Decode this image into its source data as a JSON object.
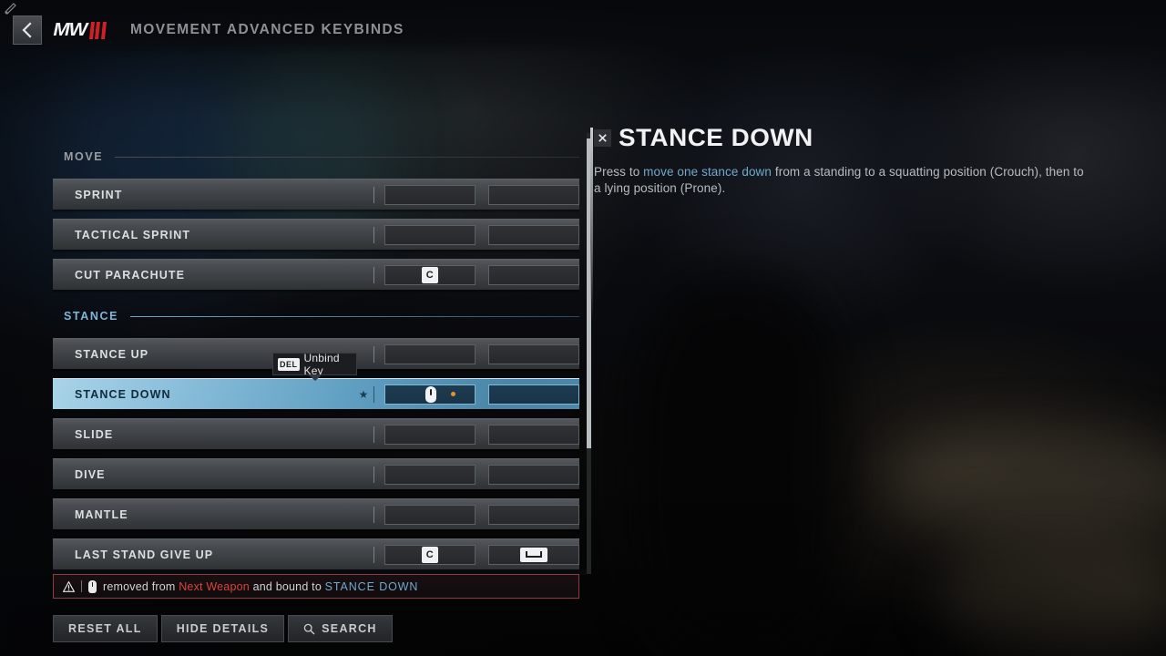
{
  "header": {
    "back_icon": "chevron-left-icon",
    "logo_text": "MW",
    "title": "MOVEMENT ADVANCED KEYBINDS"
  },
  "colors": {
    "accent_blue": "#6fa9cd",
    "selected_row": "#8cc0dc",
    "warning_red": "#d8443f",
    "warning_border": "#8d3b42",
    "key_badge": "#f0f1f2",
    "mouse_dot_orange": "#e8922a"
  },
  "list": {
    "sections": [
      {
        "label": "MOVE",
        "active": false,
        "rows": [
          {
            "label": "SPRINT",
            "bind1": "",
            "bind2": "",
            "bind1_type": "empty",
            "bind2_type": "empty"
          },
          {
            "label": "TACTICAL SPRINT",
            "bind1": "",
            "bind2": "",
            "bind1_type": "empty",
            "bind2_type": "empty"
          },
          {
            "label": "CUT PARACHUTE",
            "bind1": "C",
            "bind2": "",
            "bind1_type": "key",
            "bind2_type": "empty"
          }
        ]
      },
      {
        "label": "STANCE",
        "active": true,
        "rows": [
          {
            "label": "STANCE UP",
            "bind1": "",
            "bind2": "",
            "bind1_type": "empty",
            "bind2_type": "empty"
          },
          {
            "label": "STANCE DOWN",
            "bind1": "mouse-icon",
            "bind2": "",
            "bind1_type": "mouse",
            "bind2_type": "empty",
            "selected": true,
            "starred": true
          },
          {
            "label": "SLIDE",
            "bind1": "",
            "bind2": "",
            "bind1_type": "empty",
            "bind2_type": "empty"
          },
          {
            "label": "DIVE",
            "bind1": "",
            "bind2": "",
            "bind1_type": "empty",
            "bind2_type": "empty"
          },
          {
            "label": "MANTLE",
            "bind1": "",
            "bind2": "",
            "bind1_type": "empty",
            "bind2_type": "empty"
          },
          {
            "label": "LAST STAND GIVE UP",
            "bind1": "C",
            "bind2": "space",
            "bind1_type": "key",
            "bind2_type": "spacebar"
          }
        ]
      }
    ]
  },
  "tooltip": {
    "key": "DEL",
    "text": "Unbind Key"
  },
  "warning": {
    "icon": "warning-triangle-icon",
    "device_icon": "mouse-icon",
    "prefix": "removed from ",
    "source": "Next Weapon",
    "middle": " and bound to ",
    "target": "STANCE DOWN"
  },
  "footer": {
    "buttons": [
      {
        "label": "RESET ALL",
        "icon": ""
      },
      {
        "label": "HIDE DETAILS",
        "icon": ""
      },
      {
        "label": "SEARCH",
        "icon": "search-icon"
      }
    ]
  },
  "detail": {
    "close_icon": "close-icon",
    "title": "STANCE DOWN",
    "desc_part1": "Press to ",
    "desc_highlight": "move one stance down",
    "desc_part2": " from a standing to a squatting position (Crouch), then to a lying position (Prone)."
  }
}
